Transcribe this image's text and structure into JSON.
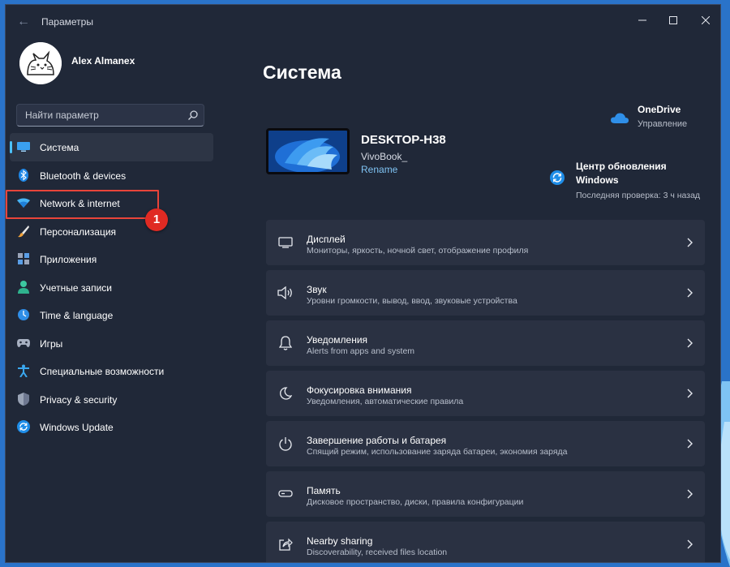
{
  "window": {
    "title": "Параметры"
  },
  "profile": {
    "name": "Alex Almanex"
  },
  "search": {
    "placeholder": "Найти параметр"
  },
  "sidebar": {
    "items": [
      {
        "label": "Система",
        "icon": "system-icon",
        "active": true
      },
      {
        "label": "Bluetooth & devices",
        "icon": "bluetooth-icon"
      },
      {
        "label": "Network & internet",
        "icon": "network-icon"
      },
      {
        "label": "Персонализация",
        "icon": "personalization-icon"
      },
      {
        "label": "Приложения",
        "icon": "apps-icon"
      },
      {
        "label": "Учетные записи",
        "icon": "accounts-icon"
      },
      {
        "label": "Time & language",
        "icon": "time-language-icon"
      },
      {
        "label": "Игры",
        "icon": "gaming-icon"
      },
      {
        "label": "Специальные возможности",
        "icon": "accessibility-icon"
      },
      {
        "label": "Privacy & security",
        "icon": "privacy-shield-icon"
      },
      {
        "label": "Windows Update",
        "icon": "windows-update-icon"
      }
    ]
  },
  "annotation": {
    "number": "1",
    "color": "#e02a23"
  },
  "main": {
    "title": "Система",
    "device": {
      "name": "DESKTOP-H38",
      "model": "VivoBook_",
      "rename_label": "Rename"
    },
    "onedrive": {
      "title": "OneDrive",
      "subtitle": "Управление"
    },
    "windows_update": {
      "title": "Центр обновления Windows",
      "subtitle": "Последняя проверка: 3 ч назад"
    },
    "cards": [
      {
        "title": "Дисплей",
        "subtitle": "Мониторы, яркость, ночной свет, отображение профиля",
        "icon": "display-icon"
      },
      {
        "title": "Звук",
        "subtitle": "Уровни громкости, вывод, ввод, звуковые устройства",
        "icon": "sound-icon"
      },
      {
        "title": "Уведомления",
        "subtitle": "Alerts from apps and system",
        "icon": "notifications-icon"
      },
      {
        "title": "Фокусировка внимания",
        "subtitle": "Уведомления, автоматические правила",
        "icon": "focus-assist-icon"
      },
      {
        "title": "Завершение работы и батарея",
        "subtitle": "Спящий режим, использование заряда батареи, экономия заряда",
        "icon": "power-icon"
      },
      {
        "title": "Память",
        "subtitle": "Дисковое пространство, диски, правила конфигурации",
        "icon": "storage-icon"
      },
      {
        "title": "Nearby sharing",
        "subtitle": "Discoverability, received files location",
        "icon": "nearby-sharing-icon"
      }
    ]
  },
  "colors": {
    "accent": "#4cc2ff",
    "window_bg": "#202838",
    "card_bg": "#2a3142",
    "highlight": "#e8443a"
  }
}
